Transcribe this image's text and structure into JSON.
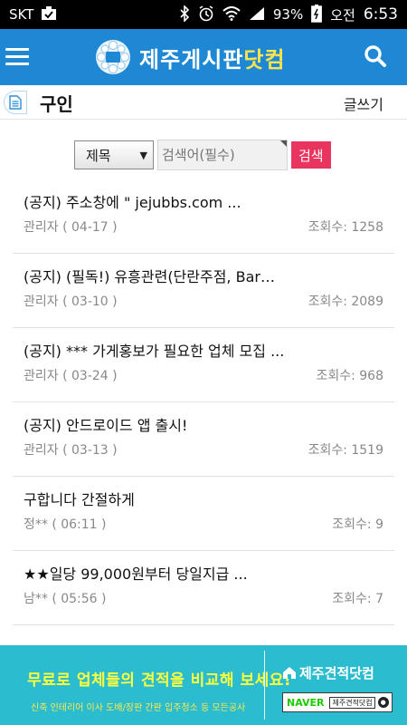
{
  "status_bar": {
    "carrier": "SKT",
    "battery": "93%",
    "ampm": "오전",
    "time": "6:53"
  },
  "header": {
    "logo_text": "제주게시판",
    "logo_accent": "닷컴",
    "menu_icon": "menu-icon",
    "search_icon": "search-icon",
    "color": "#1e88d4"
  },
  "page": {
    "title": "구인",
    "write_label": "글쓰기"
  },
  "search": {
    "field_selected": "제목",
    "placeholder": "검색어(필수)",
    "submit_label": "검색",
    "submit_color": "#e8345e"
  },
  "posts": [
    {
      "title": "(공지) 주소창에 \" jejubbs.com ...",
      "author": "관리자 ( 04-17 )",
      "views": "조회수: 1258"
    },
    {
      "title": "(공지) (필독!) 유흥관련(단란주점, Bar…",
      "author": "관리자 ( 03-10 )",
      "views": "조회수: 2089"
    },
    {
      "title": "(공지) *** 가게홍보가 필요한 업체 모집 ...",
      "author": "관리자 ( 03-24 )",
      "views": "조회수: 968"
    },
    {
      "title": "(공지) 안드로이드 앱 출시!",
      "author": "관리자 ( 03-13 )",
      "views": "조회수: 1519"
    },
    {
      "title": "구합니다 간절하게",
      "author": "정** ( 06:11 )",
      "views": "조회수: 9"
    },
    {
      "title": "★★일당 99,000원부터 당일지급 ...",
      "author": "남** ( 05:56 )",
      "views": "조회수: 7"
    }
  ],
  "banner": {
    "headline": "무료로 업체들의 견적을 비교해 보세요!",
    "categories": "신축  인테리어  이사  도배/장판  간판  입주청소 등  모든공사",
    "brand": "제주견적닷컴",
    "naver_label": "NAVER",
    "naver_search": "제주견적닷컴",
    "background": "#2bbcd0"
  }
}
